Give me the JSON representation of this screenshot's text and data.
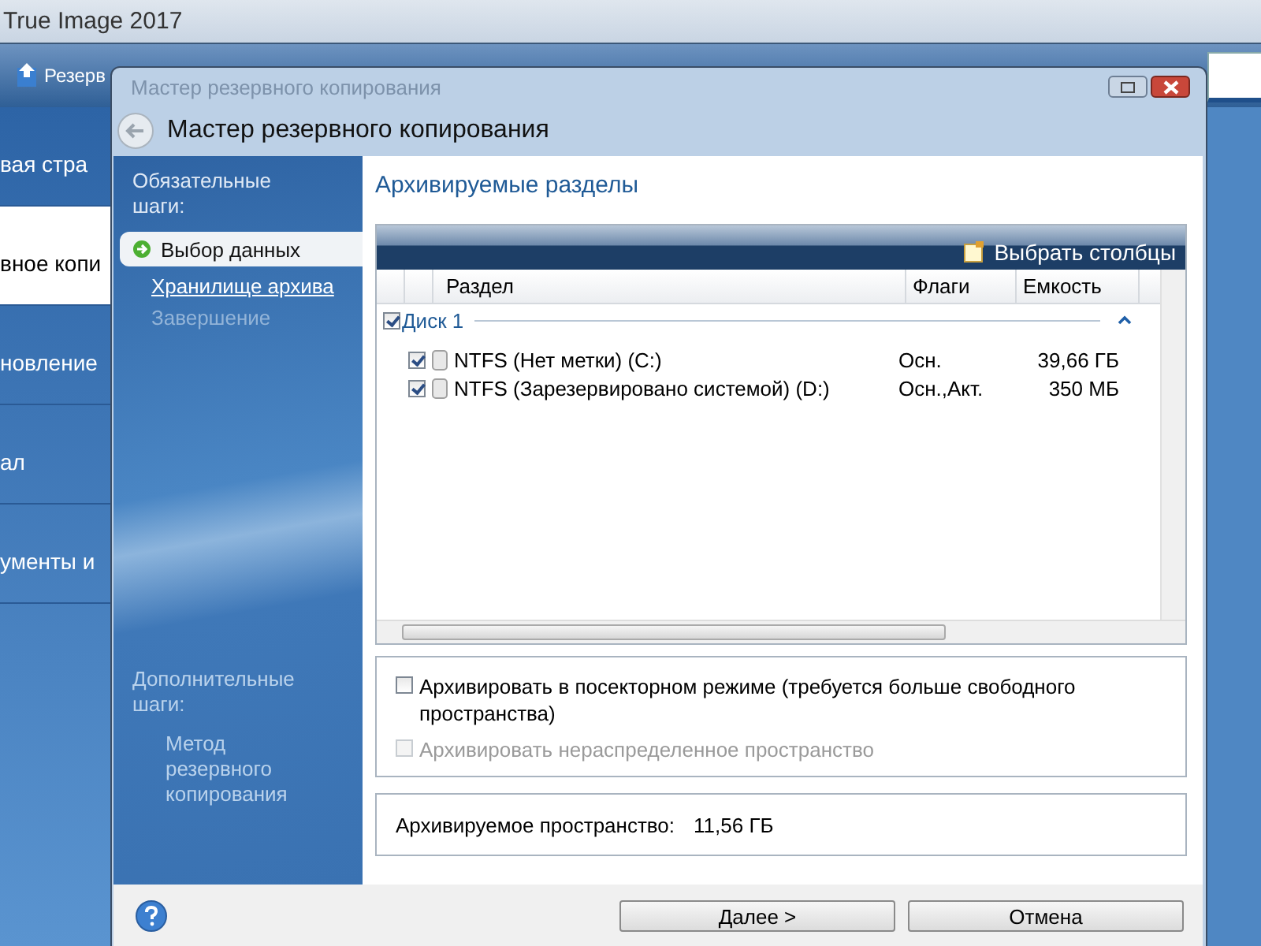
{
  "app": {
    "title": "True Image 2017",
    "toolbar_item": "Резерв",
    "nav": [
      {
        "label": "вая стра",
        "selected": false
      },
      {
        "label": "вное копи",
        "selected": true
      },
      {
        "label": "новление",
        "selected": false
      },
      {
        "label": "ал",
        "selected": false
      },
      {
        "label": "ументы и",
        "selected": false
      }
    ]
  },
  "dialog": {
    "caption": "Мастер резервного копирования",
    "title": "Мастер резервного копирования",
    "steps_heading": "Обязательные шаги:",
    "steps": [
      {
        "label": "Выбор данных",
        "kind": "current"
      },
      {
        "label": "Хранилище архива",
        "kind": "link"
      },
      {
        "label": "Завершение",
        "kind": "disabled"
      }
    ],
    "optional_heading": "Дополнительные шаги:",
    "optional_steps": [
      {
        "label": "Метод резервного копирования",
        "kind": "disabled"
      }
    ],
    "page_title": "Архивируемые разделы",
    "choose_columns": "Выбрать столбцы",
    "table": {
      "columns": [
        "Раздел",
        "Флаги",
        "Емкость"
      ],
      "group": {
        "label": "Диск 1",
        "checked": true,
        "expanded": true
      },
      "rows": [
        {
          "checked": true,
          "cells": [
            "NTFS (Нет метки) (C:)",
            "Осн.",
            "39,66 ГБ"
          ]
        },
        {
          "checked": true,
          "cells": [
            "NTFS (Зарезервировано системой) (D:)",
            "Осн.,Акт.",
            "350 МБ"
          ]
        }
      ]
    },
    "options": [
      {
        "label": "Архивировать в посекторном режиме (требуется больше свободного пространства)",
        "checked": false,
        "disabled": false
      },
      {
        "label": "Архивировать нераспределенное пространство",
        "checked": false,
        "disabled": true
      }
    ],
    "space_label": "Архивируемое пространство:",
    "space_value": "11,56 ГБ",
    "buttons": [
      {
        "label": "Далее >"
      },
      {
        "label": "Отмена"
      }
    ]
  }
}
